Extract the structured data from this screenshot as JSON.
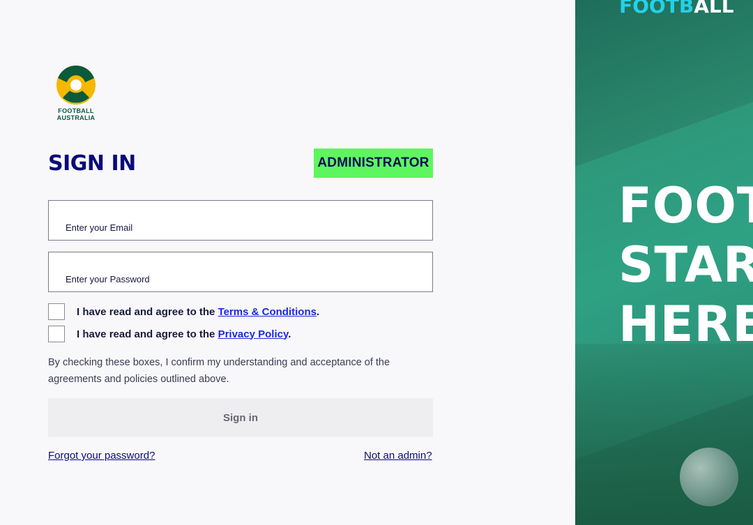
{
  "logo": {
    "line1": "FOOTBALL",
    "line2": "AUSTRALIA"
  },
  "signin": {
    "title": "SIGN IN",
    "badge": "ADMINISTRATOR"
  },
  "form": {
    "email_placeholder": "Enter your Email",
    "password_placeholder": "Enter your Password",
    "terms_prefix": "I have read and agree to the ",
    "terms_link": "Terms & Conditions",
    "terms_suffix": ".",
    "privacy_prefix": "I have read and agree to the ",
    "privacy_link": "Privacy Policy",
    "privacy_suffix": ".",
    "notice_line1": "By checking these boxes, I confirm my understanding and acceptance of the",
    "notice_line2": "agreements and policies outlined above.",
    "submit_label": "Sign in",
    "forgot_label": "Forgot your password?",
    "not_admin_label": "Not an admin?"
  },
  "hero": {
    "brand_foot": "FOOTB",
    "brand_all": "ALL",
    "line1": "FOOTBALL",
    "line2": "STARTS",
    "line3": "HERE"
  },
  "colors": {
    "title": "#0a0a7a",
    "badge_bg": "#5ef65e",
    "link": "#1a2ad8",
    "hero_bg": "#2a9a7e",
    "brand_cyan": "#24d1e8"
  }
}
